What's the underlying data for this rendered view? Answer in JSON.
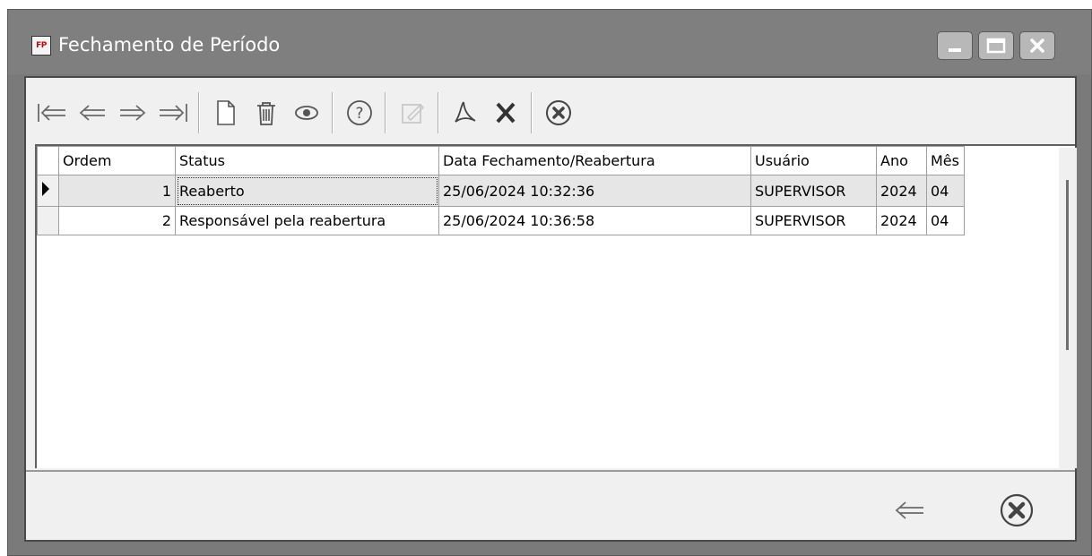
{
  "window": {
    "icon_text": "FP",
    "title": "Fechamento de Período"
  },
  "toolbar": {
    "buttons": [
      "first-icon",
      "previous-icon",
      "next-icon",
      "last-icon",
      "new-document-icon",
      "delete-icon",
      "view-icon",
      "help-icon",
      "edit-icon",
      "pdf-icon",
      "excel-icon",
      "close-circle-icon"
    ]
  },
  "table": {
    "headers": {
      "ordem": "Ordem",
      "status": "Status",
      "data": "Data Fechamento/Reabertura",
      "usuario": "Usuário",
      "ano": "Ano",
      "mes": "Mês"
    },
    "rows": [
      {
        "ordem": "1",
        "status": "Reaberto",
        "data": "25/06/2024 10:32:36",
        "usuario": "SUPERVISOR",
        "ano": "2024",
        "mes": "04"
      },
      {
        "ordem": "2",
        "status": "Responsável pela reabertura",
        "data": "25/06/2024 10:36:58",
        "usuario": "SUPERVISOR",
        "ano": "2024",
        "mes": "04"
      }
    ]
  },
  "colors": {
    "titlebar": "#7f7f7f",
    "client": "#f0f0f0",
    "selected_row": "#e6e6e6"
  }
}
